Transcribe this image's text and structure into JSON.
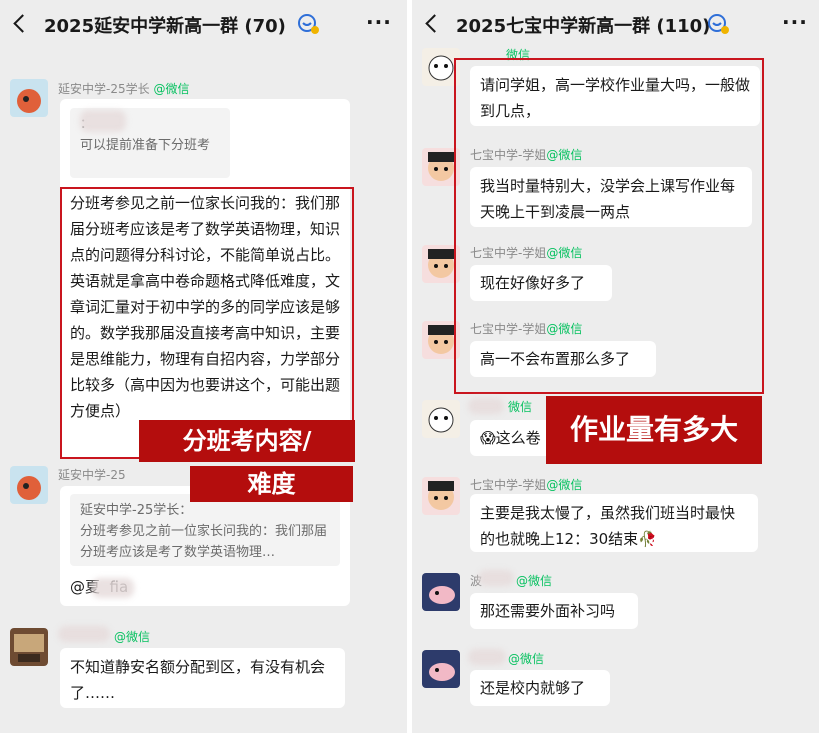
{
  "left": {
    "header": {
      "title": "2025延安中学新高一群 (70)"
    },
    "messages": [
      {
        "sender": "延安中学-25学长",
        "wechat": "@微信",
        "quote": "：\n可以提前准备下分班考",
        "text": "分班考参见之前一位家长问我的：我们那届分班考应该是考了数学英语物理，知识点的问题得分科讨论，不能简单说占比。英语就是拿高中卷命题格式降低难度，文章词汇量对于初中学的多的同学应该是够的。数学我那届没直接考高中知识，主要是思维能力，物理有自招内容，力学部分比较多（高中因为也要讲这个，可能出题方便点）"
      },
      {
        "sender": "延安中学-25",
        "quote": "延安中学-25学长：\n分班考参见之前一位家长问我的：我们那届分班考应该是考了数学英语物理…",
        "text": "@夏  fia"
      },
      {
        "wechat": "@微信",
        "text": "不知道静安名额分配到区，有没有机会了……"
      }
    ],
    "banner": {
      "line1": "分班考内容/",
      "line2": "难度"
    }
  },
  "right": {
    "header": {
      "title": "2025七宝中学新高一群 (110)"
    },
    "messages": [
      {
        "wechat": "微信",
        "text": "请问学姐，高一学校作业量大吗，一般做到几点，"
      },
      {
        "sender": "七宝中学-学姐",
        "wechat": "@微信",
        "text": "我当时量特别大，没学会上课写作业每天晚上干到凌晨一两点"
      },
      {
        "sender": "七宝中学-学姐",
        "wechat": "@微信",
        "text": "现在好像好多了"
      },
      {
        "sender": "七宝中学-学姐",
        "wechat": "@微信",
        "text": "高一不会布置那么多了"
      },
      {
        "wechat": "微信",
        "text": "😱这么卷"
      },
      {
        "sender": "七宝中学-学姐",
        "wechat": "@微信",
        "text": "主要是我太慢了，虽然我们班当时最快的也就晚上12：30结束🥀"
      },
      {
        "sender": "波",
        "wechat": "@微信",
        "text": "那还需要外面补习吗"
      },
      {
        "wechat": "@微信",
        "text": "还是校内就够了"
      }
    ],
    "banner": {
      "text": "作业量有多大"
    }
  },
  "colors": {
    "accent_red": "#c9151e",
    "banner_red": "#b40d0d",
    "wechat_green": "#07c160",
    "chat_bg": "#ededed"
  },
  "icons": [
    "back-arrow-icon",
    "voice-chat-icon",
    "more-icon"
  ]
}
